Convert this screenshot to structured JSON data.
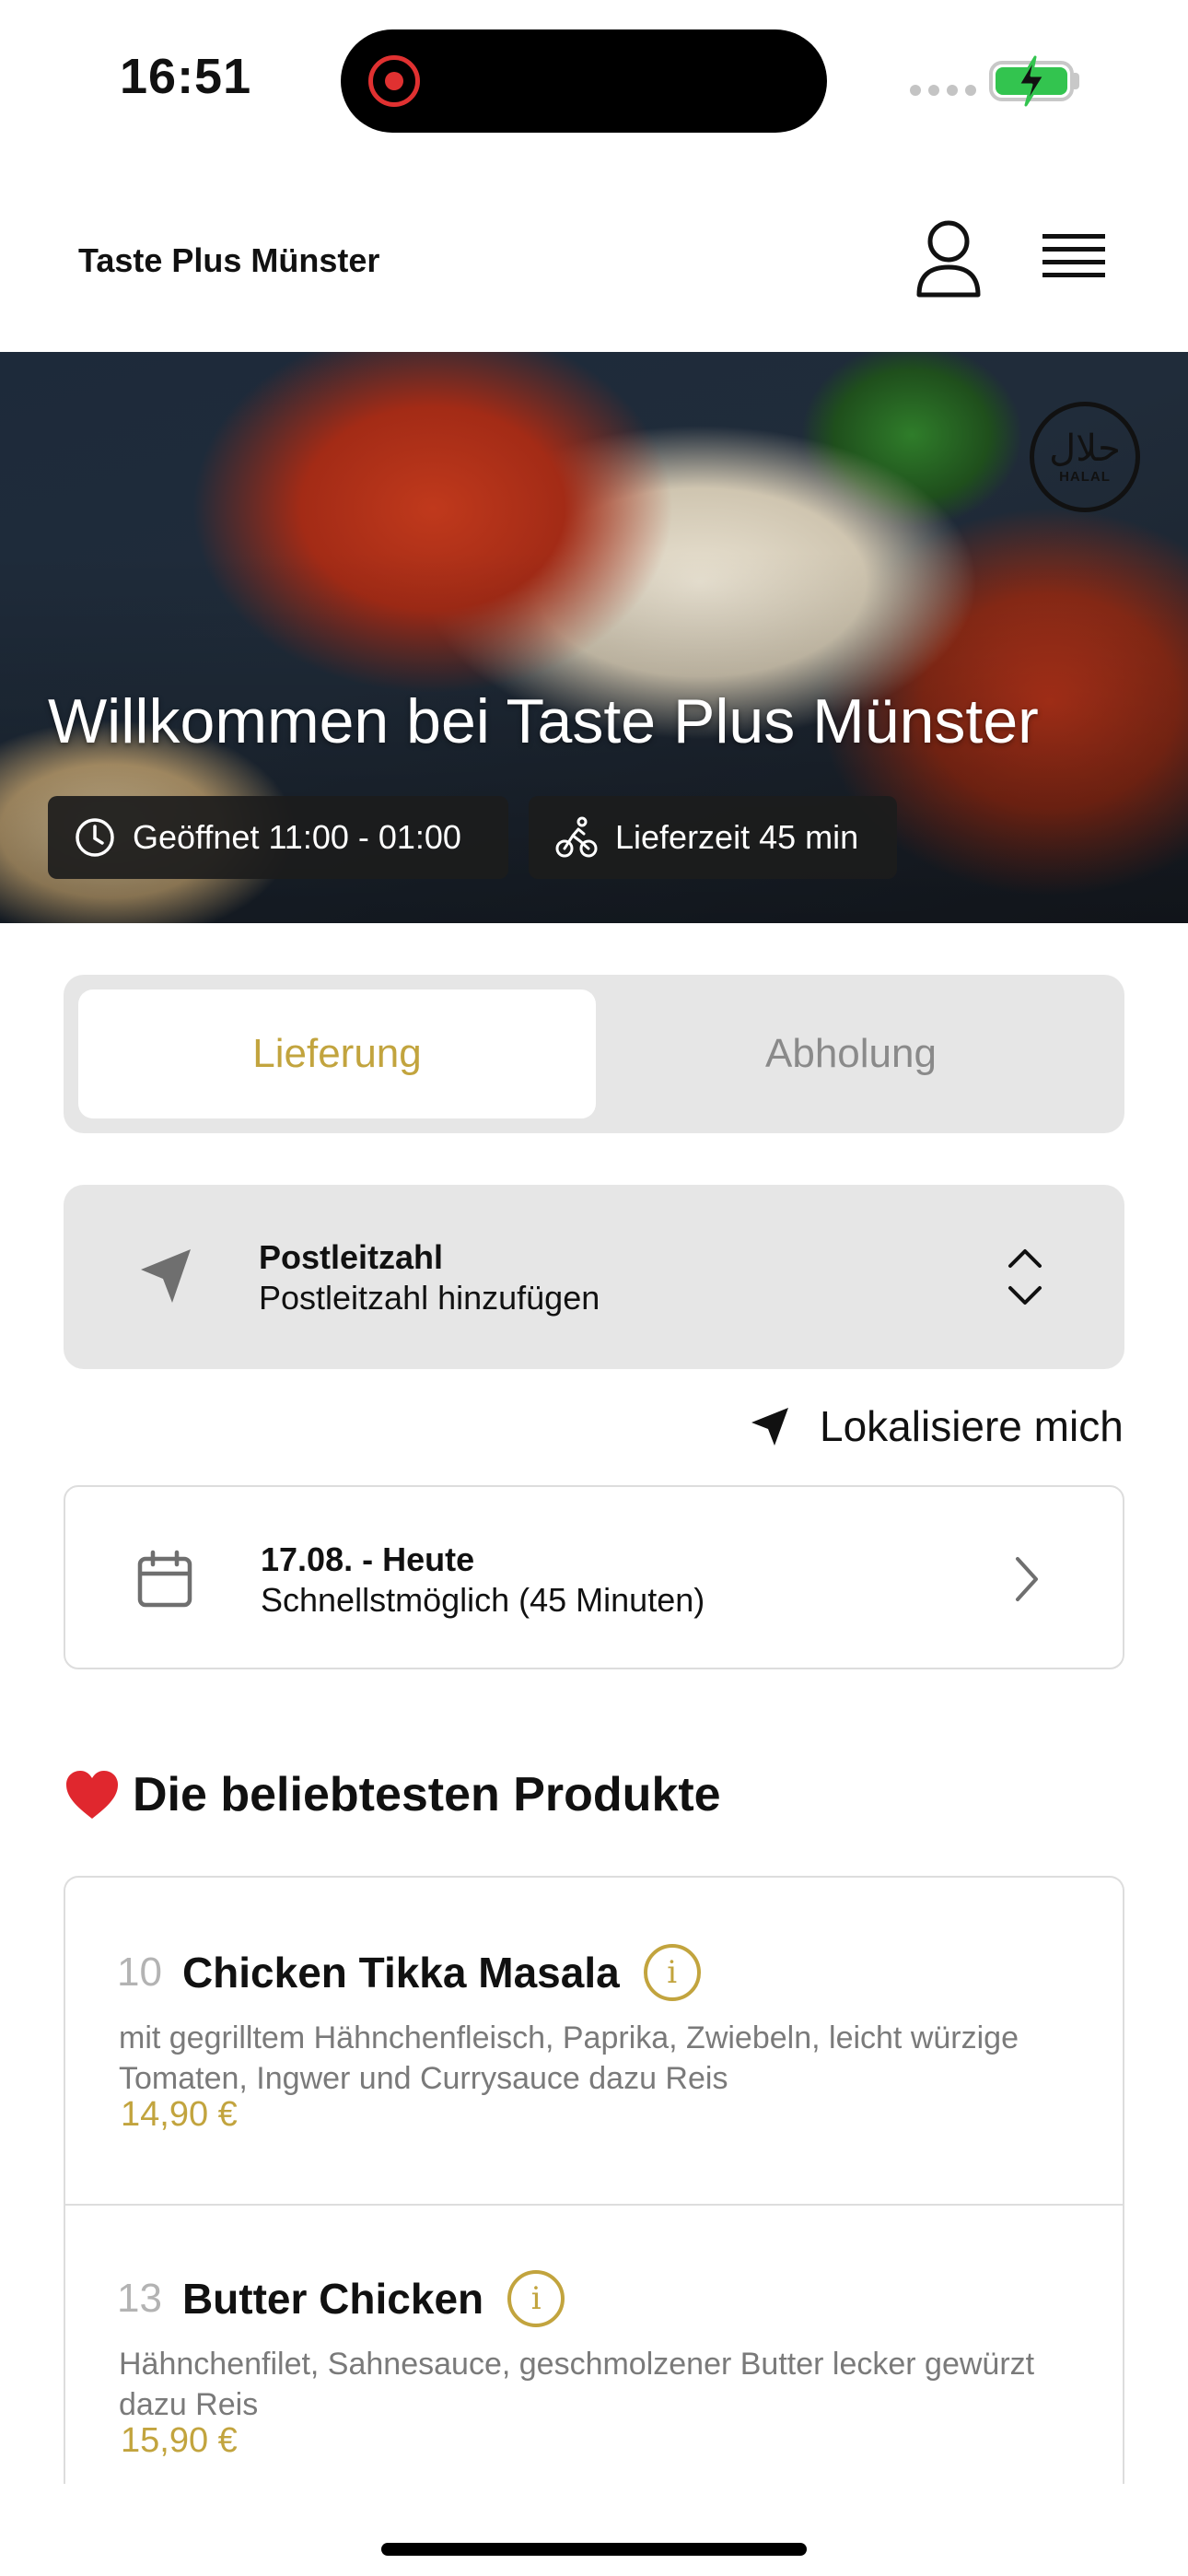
{
  "status_bar": {
    "time": "16:51"
  },
  "header": {
    "brand": "Taste Plus Münster"
  },
  "hero": {
    "badge_ar": "حلال",
    "badge_en": "HALAL",
    "title": "Willkommen bei Taste Plus Münster",
    "opening_hours": "Geöffnet 11:00 - 01:00",
    "delivery_time": "Lieferzeit 45 min"
  },
  "order_type": {
    "delivery": "Lieferung",
    "pickup": "Abholung",
    "selected": "delivery"
  },
  "postal": {
    "title": "Postleitzahl",
    "placeholder": "Postleitzahl hinzufügen"
  },
  "locate": {
    "label": "Lokalisiere mich"
  },
  "date": {
    "title": "17.08. - Heute",
    "subtitle": "Schnellstmöglich (45 Minuten)"
  },
  "popular": {
    "title": "Die beliebtesten Produkte",
    "items": [
      {
        "number": "10",
        "name": "Chicken Tikka Masala",
        "description": "mit gegrilltem Hähnchenfleisch, Paprika, Zwiebeln, leicht würzige Tomaten, Ingwer und Currysauce dazu Reis",
        "price": "14,90 €"
      },
      {
        "number": "13",
        "name": "Butter Chicken",
        "description": "Hähnchenfilet, Sahnesauce, geschmolzener Butter lecker gewürzt dazu Reis",
        "price": "15,90 €"
      }
    ]
  },
  "colors": {
    "accent": "#c2a43e",
    "muted": "#8a8a8a",
    "panel": "#e6e6e6"
  }
}
